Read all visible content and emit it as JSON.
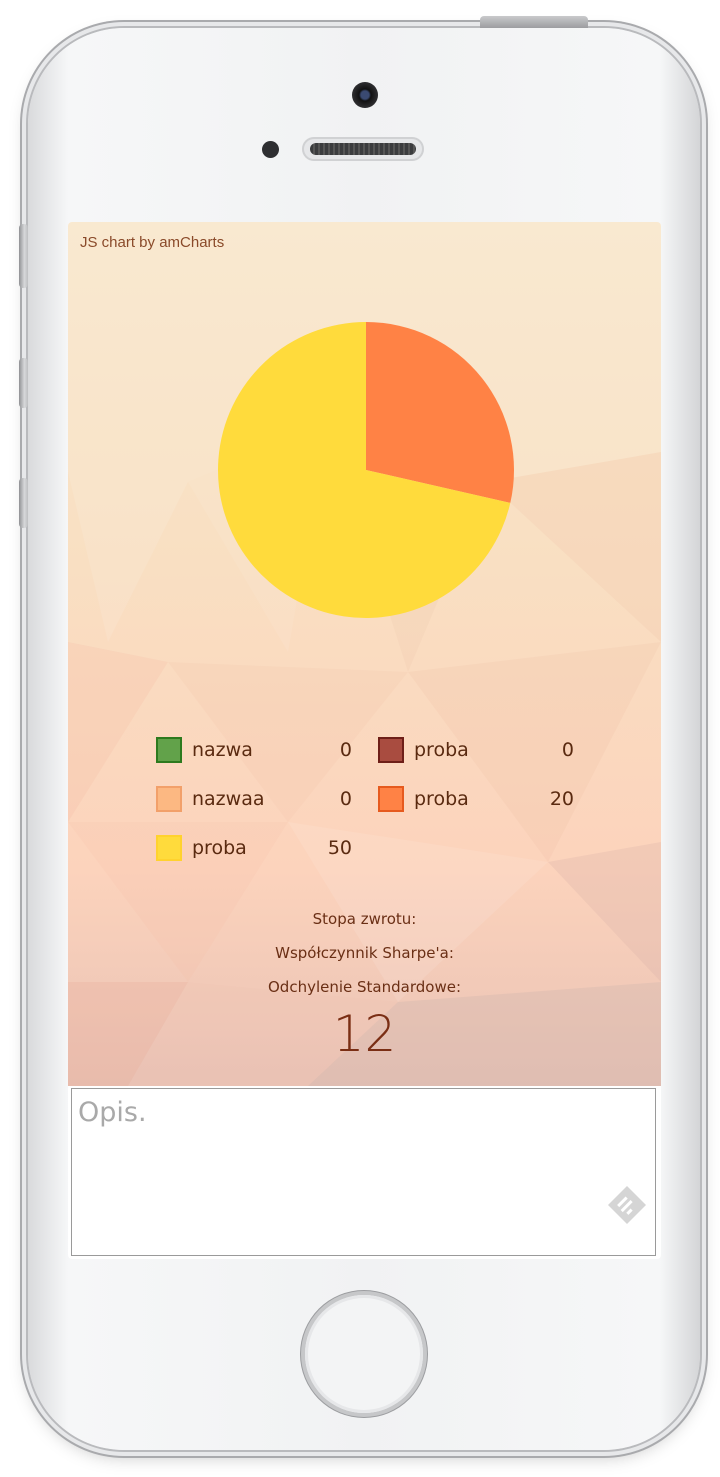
{
  "chart_data": {
    "type": "pie",
    "credit": "JS chart by amCharts",
    "slices": [
      {
        "name": "nazwa",
        "value": 0,
        "color": "#62a24a",
        "border": "#2d7a1e"
      },
      {
        "name": "proba",
        "value": 0,
        "color": "#a94c40",
        "border": "#6e1f18"
      },
      {
        "name": "nazwaa",
        "value": 0,
        "color": "#fcb882",
        "border": "#f2a06a"
      },
      {
        "name": "proba",
        "value": 20,
        "color": "#ff8245",
        "border": "#e65a1e"
      },
      {
        "name": "proba",
        "value": 50,
        "color": "#ffdb3c",
        "border": "#ffd22e"
      }
    ]
  },
  "stats": {
    "rate_label": "Stopa zwrotu:",
    "sharpe_label": "Współczynnik Sharpe'a:",
    "stddev_label": "Odchylenie Standardowe:",
    "big_number": "12"
  },
  "description": {
    "placeholder": "Opis.",
    "icon": "feedly-icon"
  }
}
